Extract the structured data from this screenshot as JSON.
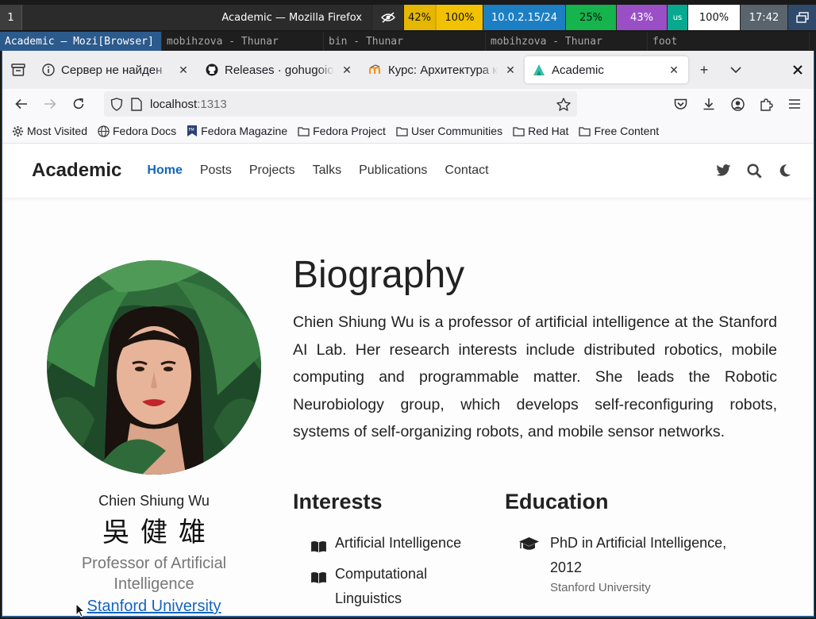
{
  "statusbar": {
    "workspace": "1",
    "window_title": "Academic — Mozilla Firefox",
    "battery": "42%",
    "volume": "100%",
    "network": "10.0.2.15/24",
    "cpu": "25%",
    "memory": "43%",
    "keyboard_layout": "us",
    "brightness": "100%",
    "clock": "17:42"
  },
  "wm_windows": [
    {
      "label": "Academic — Mozi[Browser]",
      "active": true
    },
    {
      "label": "mobihzova - Thunar",
      "active": false
    },
    {
      "label": "bin - Thunar",
      "active": false
    },
    {
      "label": "mobihzova - Thunar",
      "active": false
    },
    {
      "label": "foot",
      "active": false
    }
  ],
  "tabs": [
    {
      "label": "Сервер не найден",
      "icon": "info-icon",
      "active": false
    },
    {
      "label": "Releases · gohugoio/hugo",
      "icon": "github-icon",
      "active": false
    },
    {
      "label": "Курс: Архитектура компьютера",
      "icon": "moodle-icon",
      "active": false
    },
    {
      "label": "Academic",
      "icon": "academic-icon",
      "active": true
    }
  ],
  "url": {
    "host": "localhost",
    "port": ":1313"
  },
  "bookmarks": [
    {
      "label": "Most Visited",
      "icon": "gear-icon"
    },
    {
      "label": "Fedora Docs",
      "icon": "globe-icon"
    },
    {
      "label": "Fedora Magazine",
      "icon": "fedora-magazine-icon"
    },
    {
      "label": "Fedora Project",
      "icon": "folder-icon"
    },
    {
      "label": "User Communities",
      "icon": "folder-icon"
    },
    {
      "label": "Red Hat",
      "icon": "folder-icon"
    },
    {
      "label": "Free Content",
      "icon": "folder-icon"
    }
  ],
  "site": {
    "brand": "Academic",
    "menu": [
      {
        "label": "Home",
        "active": true
      },
      {
        "label": "Posts",
        "active": false
      },
      {
        "label": "Projects",
        "active": false
      },
      {
        "label": "Talks",
        "active": false
      },
      {
        "label": "Publications",
        "active": false
      },
      {
        "label": "Contact",
        "active": false
      }
    ]
  },
  "profile": {
    "name": "Chien Shiung Wu",
    "name_cn": "吳健雄",
    "role": "Professor of Artificial Intelligence",
    "org": "Stanford University"
  },
  "biography": {
    "heading": "Biography",
    "text": "Chien Shiung Wu is a professor of artificial intelligence at the Stanford AI Lab. Her research interests include distributed robotics, mobile computing and programmable matter. She leads the Robotic Neurobiology group, which develops self-reconfiguring robots, systems of self-organizing robots, and mobile sensor networks."
  },
  "interests": {
    "heading": "Interests",
    "items": [
      "Artificial Intelligence",
      "Computational Linguistics"
    ]
  },
  "education": {
    "heading": "Education",
    "items": [
      {
        "degree": "PhD in Artificial Intelligence, 2012",
        "institution": "Stanford University"
      }
    ]
  },
  "colors": {
    "accent": "#1565c0",
    "wm_active": "#2c5a8c"
  }
}
